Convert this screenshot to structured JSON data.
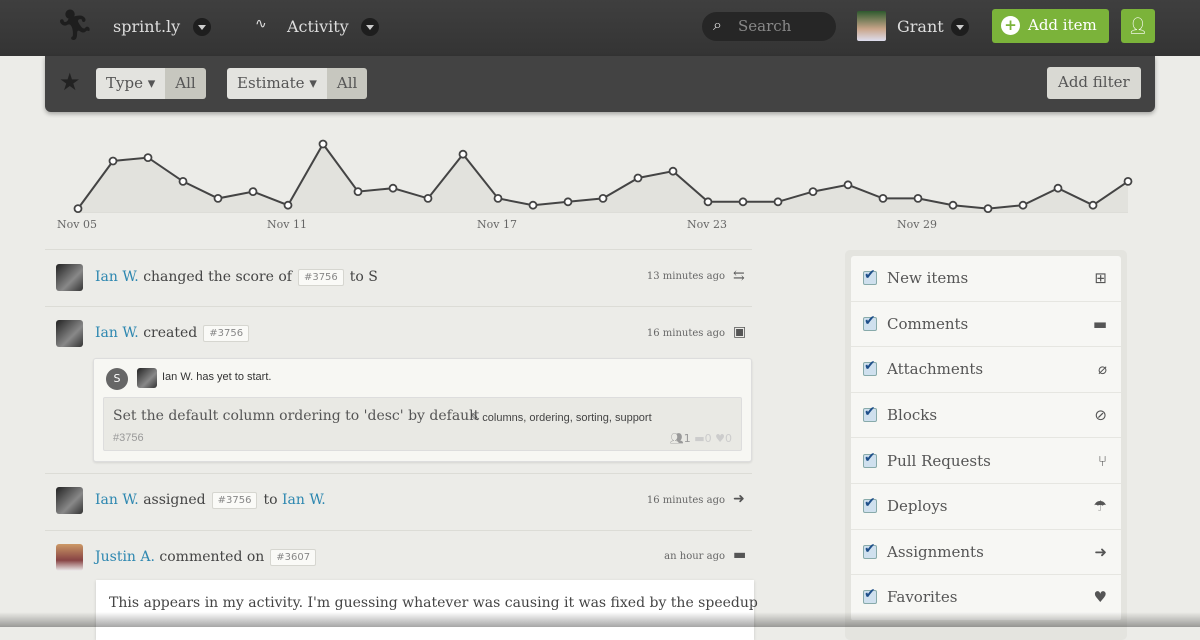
{
  "topbar": {
    "app_name": "sprint.ly",
    "section": "Activity",
    "search_placeholder": "Search",
    "user": "Grant",
    "add_item": "Add item"
  },
  "filters": {
    "type_label": "Type",
    "type_value": "All",
    "estimate_label": "Estimate",
    "estimate_value": "All",
    "add_filter": "Add filter"
  },
  "chart_data": {
    "type": "line",
    "x": [
      "Nov 05",
      "Nov 06",
      "Nov 07",
      "Nov 08",
      "Nov 09",
      "Nov 10",
      "Nov 11",
      "Nov 12",
      "Nov 13",
      "Nov 14",
      "Nov 15",
      "Nov 16",
      "Nov 17",
      "Nov 18",
      "Nov 19",
      "Nov 20",
      "Nov 21",
      "Nov 22",
      "Nov 23",
      "Nov 24",
      "Nov 25",
      "Nov 26",
      "Nov 27",
      "Nov 28",
      "Nov 29",
      "Nov 30",
      "Dec 01",
      "Dec 02",
      "Dec 03",
      "Dec 04",
      "Dec 05"
    ],
    "values": [
      1,
      15,
      16,
      9,
      4,
      6,
      2,
      20,
      6,
      7,
      4,
      17,
      4,
      2,
      3,
      4,
      10,
      12,
      3,
      3,
      3,
      6,
      8,
      4,
      4,
      2,
      1,
      2,
      7,
      2,
      9
    ],
    "tick_labels": [
      "Nov 05",
      "Nov 11",
      "Nov 17",
      "Nov 23",
      "Nov 29"
    ],
    "grid": false,
    "color": "#444444"
  },
  "feed": [
    {
      "user": "Ian W.",
      "action": "changed the score of",
      "item": "#3756",
      "suffix": "to S",
      "time": "13 minutes ago",
      "icon": "score-icon"
    },
    {
      "user": "Ian W.",
      "action": "created",
      "item": "#3756",
      "time": "16 minutes ago",
      "icon": "new-item-icon",
      "card": {
        "size": "S",
        "status": "Ian W. has yet to start.",
        "title": "Set the default column ordering to 'desc' by default",
        "tags": "columns, ordering, sorting, support",
        "number": "#3756",
        "assignees": "1",
        "comments": "0",
        "favorites": "0"
      }
    },
    {
      "user": "Ian W.",
      "action": "assigned",
      "item": "#3756",
      "suffix_pre": "to",
      "suffix_user": "Ian W.",
      "time": "16 minutes ago",
      "icon": "assign-icon"
    },
    {
      "user": "Justin A.",
      "action": "commented on",
      "item": "#3607",
      "time": "an hour ago",
      "icon": "comment-icon",
      "comment": "This appears in my activity. I'm guessing whatever was causing it was fixed by the speedup"
    }
  ],
  "sidebar": {
    "items": [
      {
        "label": "New items",
        "checked": true,
        "icon": "⊞"
      },
      {
        "label": "Comments",
        "checked": true,
        "icon": "▬"
      },
      {
        "label": "Attachments",
        "checked": true,
        "icon": "⌀"
      },
      {
        "label": "Blocks",
        "checked": true,
        "icon": "⊘"
      },
      {
        "label": "Pull Requests",
        "checked": true,
        "icon": "⑂"
      },
      {
        "label": "Deploys",
        "checked": true,
        "icon": "☂"
      },
      {
        "label": "Assignments",
        "checked": true,
        "icon": "➜"
      },
      {
        "label": "Favorites",
        "checked": true,
        "icon": "♥"
      }
    ]
  },
  "colors": {
    "accent_green": "#7bb33a",
    "link": "#2d87b0",
    "topbar": "#3a3a3a"
  }
}
